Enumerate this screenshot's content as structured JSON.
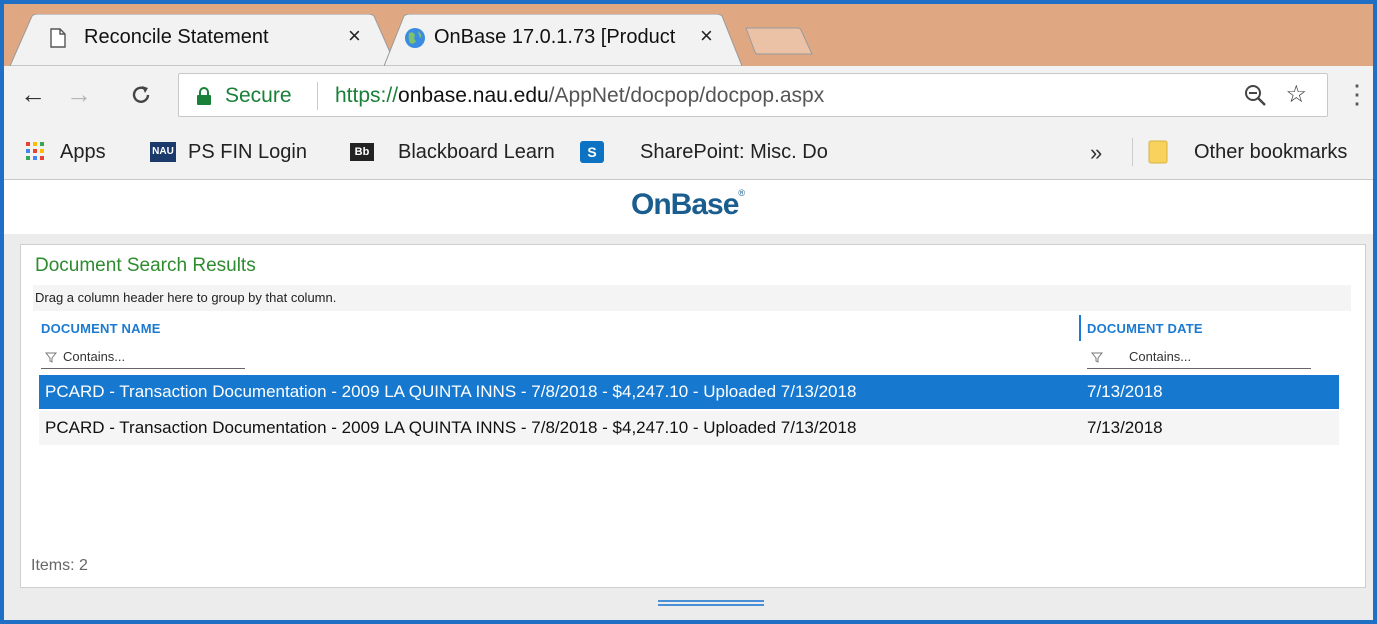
{
  "browser": {
    "tabs": [
      {
        "title": "Reconcile Statement",
        "icon": "page-icon",
        "close": "×"
      },
      {
        "title": "OnBase 17.0.1.73 [Product",
        "icon": "globe-icon",
        "close": "×"
      }
    ],
    "omnibox": {
      "secure_label": "Secure",
      "url_scheme": "https://",
      "url_host": "onbase.nau.edu",
      "url_path": "/AppNet/docpop/docpop.aspx"
    },
    "bookmarks": [
      {
        "label": "Apps",
        "icon": "apps-grid-icon"
      },
      {
        "label": "PS FIN Login",
        "icon": "nau-logo-icon",
        "icon_text": "NAU"
      },
      {
        "label": "Blackboard Learn",
        "icon": "blackboard-icon",
        "icon_text": "Bb"
      },
      {
        "label": "SharePoint: Misc. Do",
        "icon": "sharepoint-icon",
        "icon_text": "S"
      }
    ],
    "overflow_label": "»",
    "other_bookmarks": "Other bookmarks",
    "colors": {
      "frame": "#1f6fc4",
      "tabstrip": "#dfa882",
      "secure_green": "#188038"
    }
  },
  "page": {
    "logo": "OnBase",
    "logo_mark": "®",
    "panel_title": "Document Search Results",
    "group_hint": "Drag a column header here to group by that column.",
    "columns": [
      {
        "header": "DOCUMENT NAME",
        "filter_placeholder": "Contains..."
      },
      {
        "header": "DOCUMENT DATE",
        "filter_placeholder": "Contains..."
      }
    ],
    "rows": [
      {
        "name": "PCARD - Transaction Documentation - 2009 LA QUINTA INNS - 7/8/2018 - $4,247.10 - Uploaded 7/13/2018",
        "date": "7/13/2018",
        "selected": true
      },
      {
        "name": "PCARD - Transaction Documentation - 2009 LA QUINTA INNS - 7/8/2018 - $4,247.10 - Uploaded 7/13/2018",
        "date": "7/13/2018",
        "selected": false
      }
    ],
    "items_count": "Items: 2",
    "colors": {
      "title_green": "#2e8b2e",
      "header_blue": "#1c7bd1",
      "selection": "#1679cf"
    }
  }
}
